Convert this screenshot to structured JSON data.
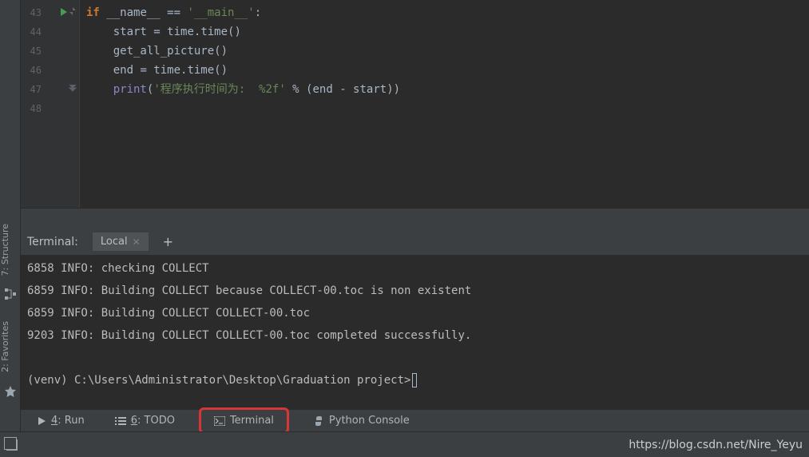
{
  "left_strip": {
    "structure_label": "7: Structure",
    "favorites_label": "2: Favorites"
  },
  "code_lines": [
    {
      "n": "43",
      "indent": 0,
      "tokens": [
        [
          "kw",
          "if "
        ],
        [
          "name",
          "__name__ "
        ],
        [
          "op",
          "== "
        ],
        [
          "str",
          "'__main__'"
        ],
        [
          "op",
          ":"
        ]
      ]
    },
    {
      "n": "44",
      "indent": 1,
      "tokens": [
        [
          "name",
          "start "
        ],
        [
          "op",
          "= "
        ],
        [
          "name",
          "time"
        ],
        [
          "op",
          "."
        ],
        [
          "fn",
          "time"
        ],
        [
          "paren",
          "()"
        ]
      ]
    },
    {
      "n": "45",
      "indent": 1,
      "tokens": [
        [
          "fn",
          "get_all_picture"
        ],
        [
          "paren",
          "()"
        ]
      ]
    },
    {
      "n": "46",
      "indent": 1,
      "tokens": [
        [
          "name",
          "end "
        ],
        [
          "op",
          "= "
        ],
        [
          "name",
          "time"
        ],
        [
          "op",
          "."
        ],
        [
          "fn",
          "time"
        ],
        [
          "paren",
          "()"
        ]
      ]
    },
    {
      "n": "47",
      "indent": 1,
      "tokens": [
        [
          "builtin",
          "print"
        ],
        [
          "paren",
          "("
        ],
        [
          "str",
          "'程序执行时间为:  %2f'"
        ],
        [
          "op",
          " % "
        ],
        [
          "paren",
          "(end - start))"
        ]
      ]
    },
    {
      "n": "48",
      "indent": 0,
      "tokens": []
    }
  ],
  "terminal": {
    "header_label": "Terminal:",
    "tab_label": "Local",
    "plus": "+",
    "lines": [
      "6858 INFO: checking COLLECT",
      "6859 INFO: Building COLLECT because COLLECT-00.toc is non existent",
      "6859 INFO: Building COLLECT COLLECT-00.toc",
      "9203 INFO: Building COLLECT COLLECT-00.toc completed successfully.",
      "",
      "(venv) C:\\Users\\Administrator\\Desktop\\Graduation project>"
    ]
  },
  "toolbar": {
    "run": {
      "key": "4",
      "label": ": Run"
    },
    "todo": {
      "key": "6",
      "label": ": TODO"
    },
    "terminal": {
      "label": "Terminal"
    },
    "python_console": {
      "label": "Python Console"
    }
  },
  "statusbar": {
    "right": "https://blog.csdn.net/Nire_Yeyu"
  }
}
